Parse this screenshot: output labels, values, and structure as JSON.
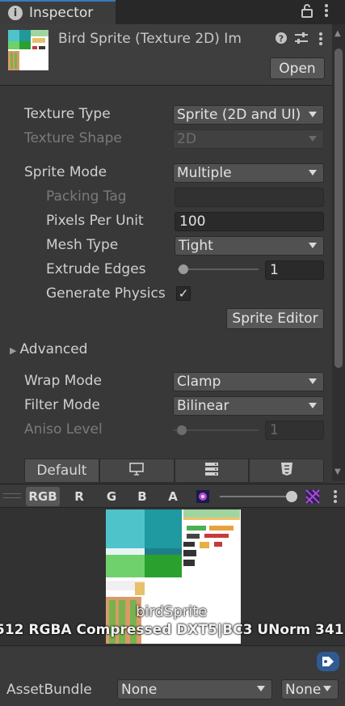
{
  "window": {
    "tab_title": "Inspector",
    "tab_icons": [
      "lock-icon",
      "kebab-menu-icon"
    ]
  },
  "header": {
    "title": "Bird Sprite (Texture 2D) Im",
    "open_button": "Open",
    "icons": [
      "help-icon",
      "presets-icon",
      "kebab-menu-icon"
    ]
  },
  "properties": {
    "texture_type": {
      "label": "Texture Type",
      "value": "Sprite (2D and UI)"
    },
    "texture_shape": {
      "label": "Texture Shape",
      "value": "2D"
    },
    "sprite_mode": {
      "label": "Sprite Mode",
      "value": "Multiple"
    },
    "packing_tag": {
      "label": "Packing Tag",
      "value": ""
    },
    "pixels_per_unit": {
      "label": "Pixels Per Unit",
      "value": "100"
    },
    "mesh_type": {
      "label": "Mesh Type",
      "value": "Tight"
    },
    "extrude_edges": {
      "label": "Extrude Edges",
      "value": "1",
      "slider_fraction": 0.03
    },
    "generate_physics": {
      "label": "Generate Physics",
      "checked": true,
      "check_glyph": "✓"
    },
    "sprite_editor_button": "Sprite Editor",
    "advanced": {
      "label": "Advanced",
      "expanded": false
    },
    "wrap_mode": {
      "label": "Wrap Mode",
      "value": "Clamp"
    },
    "filter_mode": {
      "label": "Filter Mode",
      "value": "Bilinear"
    },
    "aniso_level": {
      "label": "Aniso Level",
      "value": "1",
      "slider_fraction": 0.0
    }
  },
  "platform_tabs": {
    "items": [
      {
        "label": "Default",
        "icon": ""
      },
      {
        "label": "",
        "icon": "monitor-icon"
      },
      {
        "label": "",
        "icon": "server-icon"
      },
      {
        "label": "",
        "icon": "html5-icon"
      }
    ]
  },
  "preview": {
    "channels": [
      "RGB",
      "R",
      "G",
      "B",
      "A"
    ],
    "active_channel": "RGB",
    "mip_slider_fraction": 1.0,
    "sprite_name": "birdSprite",
    "info_text": "512  RGBA Compressed DXT5|BC3 UNorm   341"
  },
  "asset_bundle": {
    "label": "AssetBundle",
    "name_value": "None",
    "variant_value": "None"
  },
  "colors": {
    "accent": "#3a79bb",
    "background": "#383838",
    "sky": "#4fc3ca",
    "grass": "#63c25a"
  }
}
